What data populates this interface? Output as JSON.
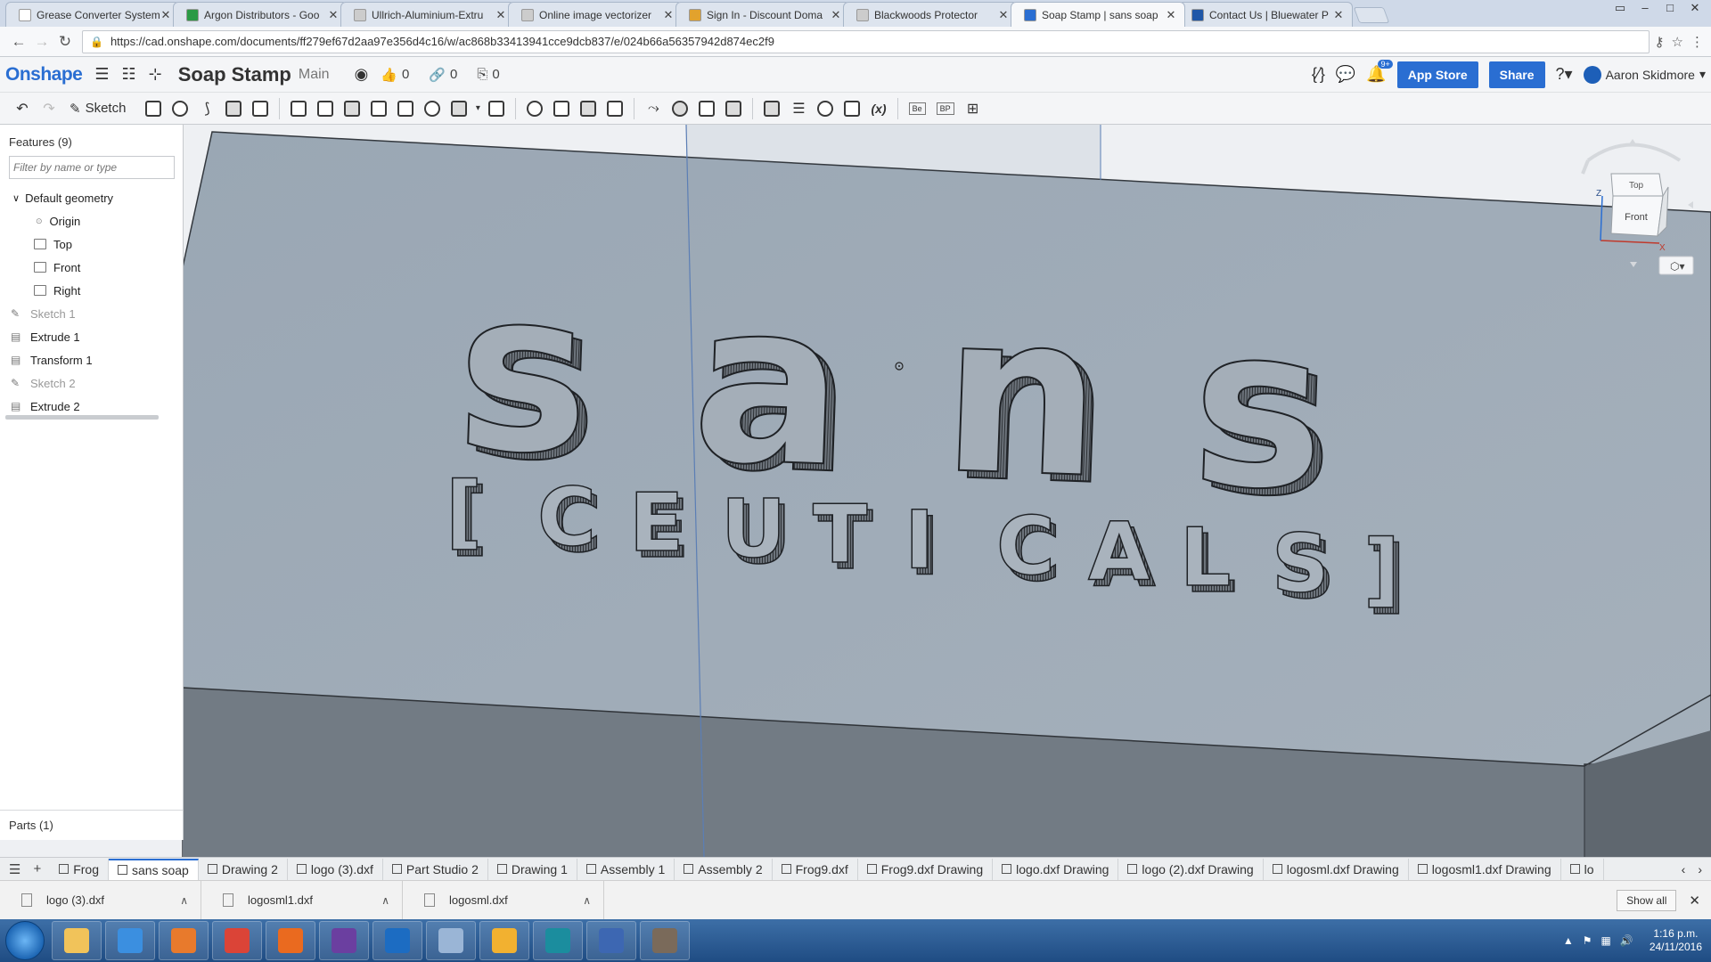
{
  "browser": {
    "tabs": [
      {
        "title": "Grease Converter System",
        "color": "#ffffff"
      },
      {
        "title": "Argon Distributors - Goo",
        "color": "#2b9a45"
      },
      {
        "title": "Ullrich-Aluminium-Extru",
        "color": "#cccccc"
      },
      {
        "title": "Online image vectorizer",
        "color": "#cccccc"
      },
      {
        "title": "Sign In - Discount Doma",
        "color": "#e2a22d"
      },
      {
        "title": "Blackwoods Protector",
        "color": "#cccccc"
      },
      {
        "title": "Soap Stamp | sans soap",
        "color": "#2a6ed2",
        "active": true
      },
      {
        "title": "Contact Us | Bluewater P",
        "color": "#1f57a8"
      }
    ],
    "url": "https://cad.onshape.com/documents/ff279ef67d2aa97e356d4c16/w/ac868b33413941cce9dcb837/e/024b66a56357942d874ec2f9"
  },
  "header": {
    "logo": "Onshape",
    "doc_title": "Soap Stamp",
    "workspace": "Main",
    "likes": "0",
    "links": "0",
    "copies": "0",
    "app_store": "App Store",
    "share": "Share",
    "notifications": "9+",
    "user": "Aaron Skidmore"
  },
  "toolbar": {
    "sketch": "Sketch",
    "variable": "(x)",
    "be": "Be",
    "bp": "BP"
  },
  "features": {
    "title": "Features (9)",
    "filter_placeholder": "Filter by name or type",
    "default_geometry": "Default geometry",
    "origin": "Origin",
    "planes": [
      "Top",
      "Front",
      "Right"
    ],
    "items": [
      {
        "label": "Sketch 1",
        "dim": true
      },
      {
        "label": "Extrude 1",
        "dim": false
      },
      {
        "label": "Transform 1",
        "dim": false
      },
      {
        "label": "Sketch 2",
        "dim": true
      },
      {
        "label": "Extrude 2",
        "dim": false
      }
    ],
    "parts": "Parts (1)"
  },
  "viewcube": {
    "top": "Top",
    "front": "Front",
    "z": "Z",
    "x": "X"
  },
  "model_text": {
    "main": "sans",
    "sub": [
      "[",
      "C",
      "E",
      "U",
      "T",
      "I",
      "C",
      "A",
      "L",
      "S",
      "]"
    ]
  },
  "bottom_tabs": [
    {
      "label": "Frog",
      "active": false
    },
    {
      "label": "sans soap",
      "active": true
    },
    {
      "label": "Drawing 2",
      "active": false
    },
    {
      "label": "logo (3).dxf",
      "active": false
    },
    {
      "label": "Part Studio 2",
      "active": false
    },
    {
      "label": "Drawing 1",
      "active": false
    },
    {
      "label": "Assembly 1",
      "active": false
    },
    {
      "label": "Assembly 2",
      "active": false
    },
    {
      "label": "Frog9.dxf",
      "active": false
    },
    {
      "label": "Frog9.dxf Drawing",
      "active": false
    },
    {
      "label": "logo.dxf Drawing",
      "active": false
    },
    {
      "label": "logo (2).dxf Drawing",
      "active": false
    },
    {
      "label": "logosml.dxf Drawing",
      "active": false
    },
    {
      "label": "logosml1.dxf Drawing",
      "active": false
    },
    {
      "label": "lo",
      "active": false
    }
  ],
  "downloads": {
    "items": [
      "logo (3).dxf",
      "logosml1.dxf",
      "logosml.dxf"
    ],
    "show_all": "Show all"
  },
  "taskbar": {
    "apps": [
      {
        "name": "explorer",
        "color": "#f1c35a"
      },
      {
        "name": "internet-explorer",
        "color": "#3b8fe0"
      },
      {
        "name": "media-player",
        "color": "#e87a2c"
      },
      {
        "name": "chrome",
        "color": "#db4437"
      },
      {
        "name": "app-badge",
        "color": "#ea6a1f"
      },
      {
        "name": "visual-studio",
        "color": "#6b3fa0"
      },
      {
        "name": "outlook",
        "color": "#1c6cc2"
      },
      {
        "name": "tools",
        "color": "#9ab5d6"
      },
      {
        "name": "files",
        "color": "#f2b130"
      },
      {
        "name": "eb-app",
        "color": "#1b8d9e"
      },
      {
        "name": "pc-app",
        "color": "#3d67b2"
      },
      {
        "name": "gimp",
        "color": "#7a6a5a"
      }
    ],
    "time": "1:16 p.m.",
    "date": "24/11/2016"
  }
}
